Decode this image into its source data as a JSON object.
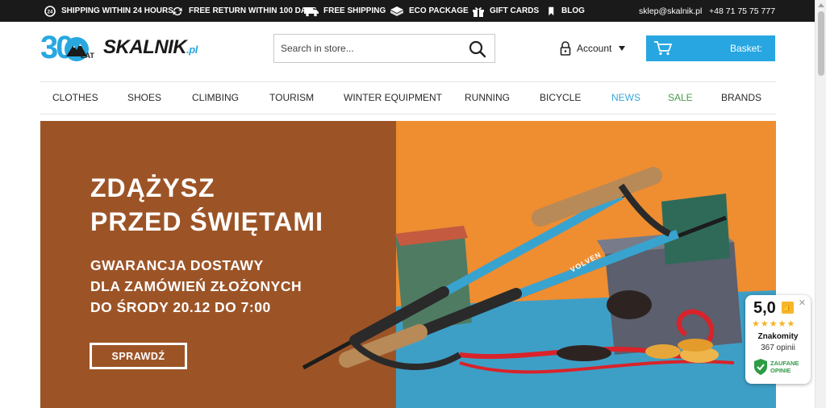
{
  "topbar": {
    "items": [
      {
        "icon": "24h-clock-icon",
        "label": "SHIPPING WITHIN 24 HOURS"
      },
      {
        "icon": "return-arrows-icon",
        "label": "FREE RETURN WITHIN 100 DAYS"
      },
      {
        "icon": "truck-icon",
        "label": "FREE SHIPPING"
      },
      {
        "icon": "eco-package-icon",
        "label": "ECO PACKAGE"
      },
      {
        "icon": "gift-icon",
        "label": "GIFT CARDS"
      },
      {
        "icon": "bookmark-icon",
        "label": "BLOG"
      }
    ],
    "email": "sklep@skalnik.pl",
    "phone": "+48 71 75 75 777"
  },
  "logo": {
    "number": "30",
    "sublabel": "LAT",
    "brand": "SKALNIK",
    "domain": ".pl"
  },
  "search": {
    "placeholder": "Search in store..."
  },
  "account": {
    "label": "Account"
  },
  "basket": {
    "label": "Basket:"
  },
  "nav": {
    "items": [
      {
        "label": "CLOTHES",
        "color": "#2a2a2a"
      },
      {
        "label": "SHOES",
        "color": "#2a2a2a"
      },
      {
        "label": "CLIMBING",
        "color": "#2a2a2a"
      },
      {
        "label": "TOURISM",
        "color": "#2a2a2a"
      },
      {
        "label": "WINTER EQUIPMENT",
        "color": "#2a2a2a"
      },
      {
        "label": "RUNNING",
        "color": "#2a2a2a"
      },
      {
        "label": "BICYCLE",
        "color": "#2a2a2a"
      },
      {
        "label": "NEWS",
        "color": "#3aa7d8"
      },
      {
        "label": "SALE",
        "color": "#4a9a4a"
      },
      {
        "label": "BRANDS",
        "color": "#2a2a2a"
      }
    ]
  },
  "banner": {
    "headline_1": "ZDĄŻYSZ",
    "headline_2": "PRZED ŚWIĘTAMI",
    "sub_1": "GWARANCJA DOSTAWY",
    "sub_2": "DLA ZAMÓWIEŃ ZŁOŻONYCH",
    "sub_3": "DO ŚRODY 20.12 DO 7:00",
    "cta": "SPRAWDŹ",
    "pole_brand": "VOLVEN"
  },
  "rating": {
    "score": "5,0",
    "stars": "★★★★★",
    "label": "Znakomity",
    "count": "367 opinii",
    "badge_1": "ZAUFANE",
    "badge_2": "OPINIE"
  },
  "colors": {
    "accent": "#27a6e1",
    "topbar_bg": "#1a1a1a",
    "banner_left": "#a65a2b",
    "banner_orange": "#ec8a2f",
    "banner_blue": "#3d9ec4"
  }
}
